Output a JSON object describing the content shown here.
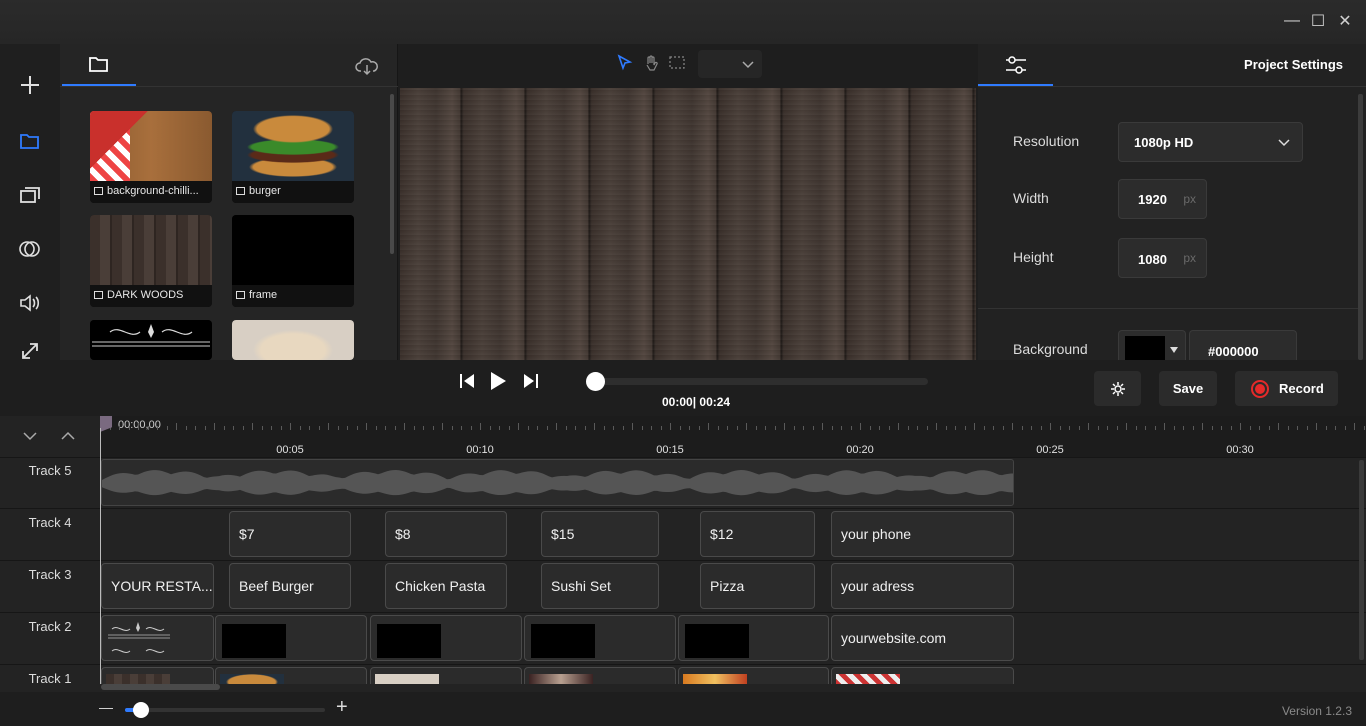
{
  "window": {
    "minimize_glyph": "—",
    "maximize_glyph": "☐",
    "close_glyph": "✕"
  },
  "left_toolbar": {
    "items": [
      {
        "icon": "plus-icon"
      },
      {
        "icon": "folder-icon"
      },
      {
        "icon": "layers-icon"
      },
      {
        "icon": "transition-icon"
      },
      {
        "icon": "volume-icon"
      },
      {
        "icon": "expand-icon"
      }
    ]
  },
  "media": {
    "tabs": [
      {
        "icon": "folder-icon"
      },
      {
        "icon": "cloud-download-icon"
      }
    ],
    "items": [
      {
        "label": "background-chilli...",
        "type": "image"
      },
      {
        "label": "burger",
        "type": "video"
      },
      {
        "label": "DARK WOODS",
        "type": "image"
      },
      {
        "label": "frame",
        "type": "video"
      },
      {
        "label": "",
        "type": "image"
      },
      {
        "label": "",
        "type": "image"
      }
    ]
  },
  "preview": {
    "tools": [
      "pointer-icon",
      "hand-icon",
      "select-rect-icon"
    ],
    "zoom_value": ""
  },
  "properties": {
    "title": "Project Settings",
    "resolution_label": "Resolution",
    "resolution_value": "1080p HD",
    "width_label": "Width",
    "width_value": "1920",
    "height_label": "Height",
    "height_value": "1080",
    "unit": "px",
    "background_label": "Background",
    "background_value": "#000000",
    "background_color": "#000000"
  },
  "playback": {
    "current_time": "00:00",
    "total_time": "00:24",
    "progress": 0,
    "save_label": "Save",
    "record_label": "Record"
  },
  "timeline": {
    "playhead_label": "00:00,00",
    "marks": [
      "00:05",
      "00:10",
      "00:15",
      "00:20",
      "00:25",
      "00:30"
    ],
    "tracks": [
      {
        "name": "Track 5"
      },
      {
        "name": "Track 4",
        "clips": [
          "$7",
          "$8",
          "$15",
          "$12",
          "your phone"
        ]
      },
      {
        "name": "Track 3",
        "clips": [
          "YOUR RESTA...",
          "Beef Burger",
          "Chicken Pasta",
          "Sushi Set",
          "Pizza",
          "your adress"
        ]
      },
      {
        "name": "Track 2",
        "clips": [
          "",
          "",
          "",
          "",
          "",
          "yourwebsite.com"
        ]
      },
      {
        "name": "Track 1"
      }
    ]
  },
  "zoom": {
    "minus": "—",
    "plus": "+",
    "level": 0.08
  },
  "version": "Version 1.2.3"
}
